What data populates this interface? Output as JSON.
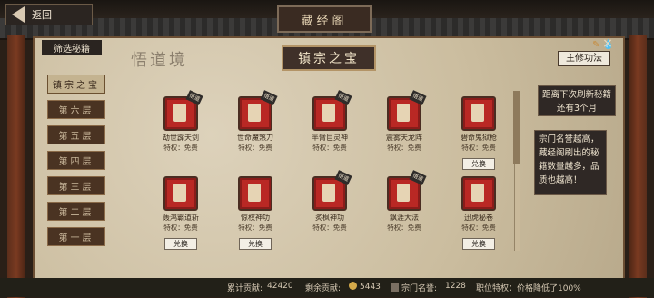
{
  "header": {
    "back_label": "返回",
    "title": "藏经阁"
  },
  "filter_label": "筛选秘籍",
  "realm_label": "悟道境",
  "banner_label": "镇宗之宝",
  "floors": [
    "镇宗之宝",
    "第六层",
    "第五层",
    "第四层",
    "第三层",
    "第二层",
    "第一层"
  ],
  "tag_label": "悟道",
  "perk_line": "特权：免费",
  "exchange_label": "兑换",
  "items": [
    {
      "name": "劫世霹天剑",
      "tag": true,
      "exchange": false
    },
    {
      "name": "世命魔煞刀",
      "tag": true,
      "exchange": false
    },
    {
      "name": "半臂巨灵神",
      "tag": true,
      "exchange": false
    },
    {
      "name": "震雾天龙阵",
      "tag": true,
      "exchange": false
    },
    {
      "name": "碧命鬼狱枪",
      "tag": false,
      "exchange": true
    },
    {
      "name": "轰鸿霸道斩",
      "tag": false,
      "exchange": true
    },
    {
      "name": "惊权神功",
      "tag": false,
      "exchange": true
    },
    {
      "name": "炙枫神功",
      "tag": true,
      "exchange": false
    },
    {
      "name": "飘涯大法",
      "tag": true,
      "exchange": false
    },
    {
      "name": "迅虎秘卷",
      "tag": false,
      "exchange": true
    }
  ],
  "skill_button": "主修功法",
  "refresh": {
    "line1": "距离下次刷新秘籍",
    "line2": "还有3个月"
  },
  "note": "宗门名誉越高，藏经阁刷出的秘籍数量越多，品质也越高！",
  "status": {
    "total_label": "累计贡献:",
    "total_value": "42420",
    "left_label": "剩余贡献:",
    "left_value": "5443",
    "rep_label": "宗门名誉:",
    "rep_value": "1228",
    "privilege": "职位特权：价格降低了100%"
  },
  "icons": [
    "back-arrow-icon",
    "coin-icon",
    "reputation-icon",
    "brush-icon",
    "water-drop-icon",
    "close-icon"
  ],
  "colors": {
    "book_red": "#b92824",
    "panel_dark": "#2f2825",
    "parchment": "#cbbd9f"
  }
}
